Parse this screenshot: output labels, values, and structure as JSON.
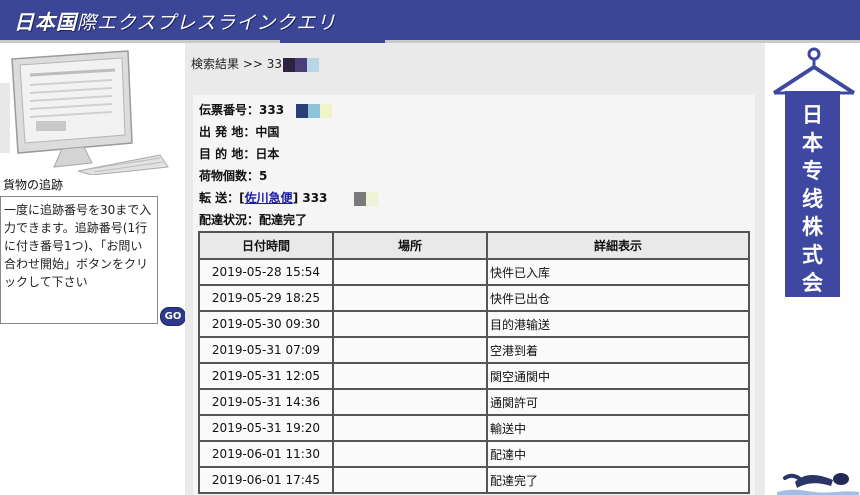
{
  "header": {
    "logo_bold": "日本国",
    "logo_rest": "際エクスプレスラインクエリ"
  },
  "sidebar": {
    "track_title": "貨物の追跡",
    "instructions": "一度に追跡番号を30まで入力できます。追跡番号(1行に付き番号1つ)、「お問い合わせ開始」ボタンをクリックして下さい",
    "go_label": "GO"
  },
  "result": {
    "breadcrumb": "検索結果 >> 333",
    "waybill_label": "伝票番号：",
    "waybill_value": "333",
    "origin_label": "出 発 地：",
    "origin_value": "中国",
    "destination_label": "目 的 地：",
    "destination_value": "日本",
    "pieces_label": "荷物個数：",
    "pieces_value": "5",
    "transfer_label": "転 送：[",
    "transfer_carrier": "佐川急便",
    "transfer_close": "]",
    "transfer_number": "333",
    "status_label": "配達状況：",
    "status_value": "配達完了"
  },
  "table": {
    "headers": [
      "日付時間",
      "場所",
      "詳細表示"
    ],
    "rows": [
      {
        "datetime": "2019-05-28 15:54",
        "place": "",
        "detail": "快件已入库"
      },
      {
        "datetime": "2019-05-29 18:25",
        "place": "",
        "detail": "快件已出仓"
      },
      {
        "datetime": "2019-05-30 09:30",
        "place": "",
        "detail": "目的港输送"
      },
      {
        "datetime": "2019-05-31 07:09",
        "place": "",
        "detail": "空港到着"
      },
      {
        "datetime": "2019-05-31 12:05",
        "place": "",
        "detail": "関空通関中"
      },
      {
        "datetime": "2019-05-31 14:36",
        "place": "",
        "detail": "通関許可"
      },
      {
        "datetime": "2019-05-31 19:20",
        "place": "",
        "detail": "輸送中"
      },
      {
        "datetime": "2019-06-01 11:30",
        "place": "",
        "detail": "配達中"
      },
      {
        "datetime": "2019-06-01 17:45",
        "place": "",
        "detail": "配達完了"
      }
    ]
  },
  "banner": {
    "text": "日本专线株式会社"
  },
  "colors": {
    "header_bg": "#3c4696",
    "banner_bg": "#3f48a0",
    "link": "#1a1aa8"
  }
}
